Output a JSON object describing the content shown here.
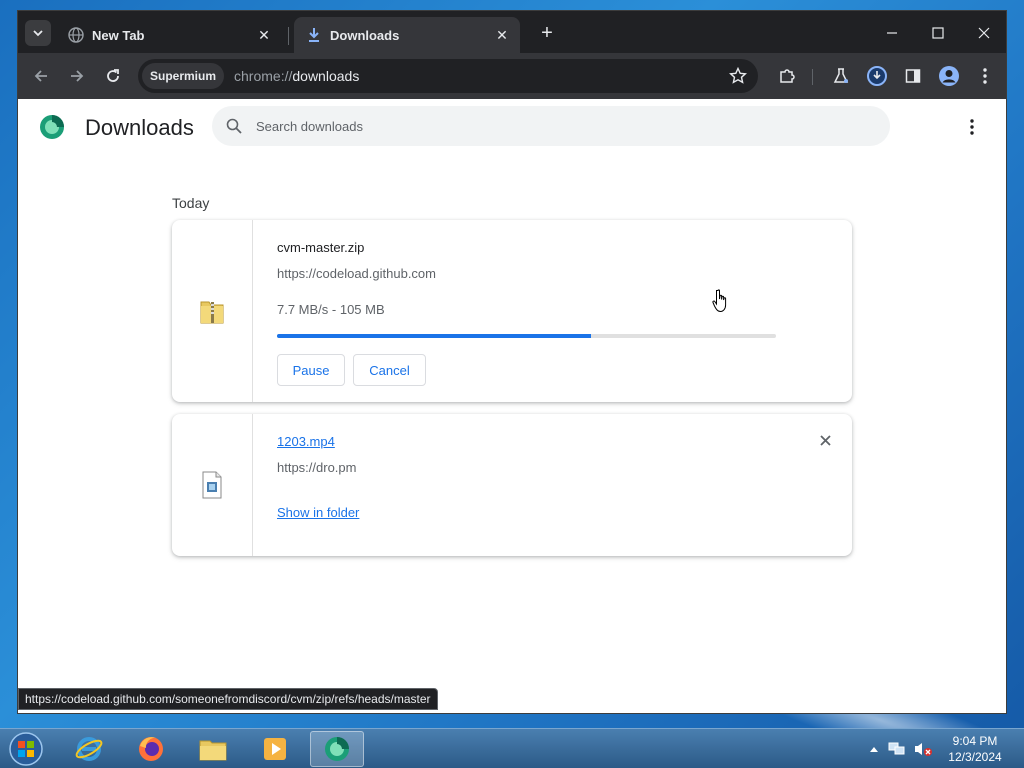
{
  "browser": {
    "tabs": [
      {
        "title": "New Tab",
        "active": false
      },
      {
        "title": "Downloads",
        "active": true
      }
    ],
    "omnibox": {
      "origin_chip": "Supermium",
      "url_scheme": "chrome://",
      "url_host": "downloads"
    }
  },
  "page": {
    "title": "Downloads",
    "search_placeholder": "Search downloads",
    "section_label": "Today",
    "downloads": [
      {
        "file_name": "cvm-master.zip",
        "url": "https://codeload.github.com",
        "status": "7.7 MB/s - 105 MB",
        "progress": 0.63,
        "buttons": [
          "Pause",
          "Cancel"
        ]
      },
      {
        "file_name": "1203.mp4",
        "url": "https://dro.pm",
        "action_link": "Show in folder"
      }
    ],
    "status_bubble": "https://codeload.github.com/someonefromdiscord/cvm/zip/refs/heads/master"
  },
  "taskbar": {
    "clock_time": "9:04 PM",
    "clock_date": "12/3/2024"
  },
  "colors": {
    "accent": "#1a73e8",
    "browser_frame": "#202124",
    "toolbar": "#35363a",
    "taskbar": "#2c5a87"
  }
}
